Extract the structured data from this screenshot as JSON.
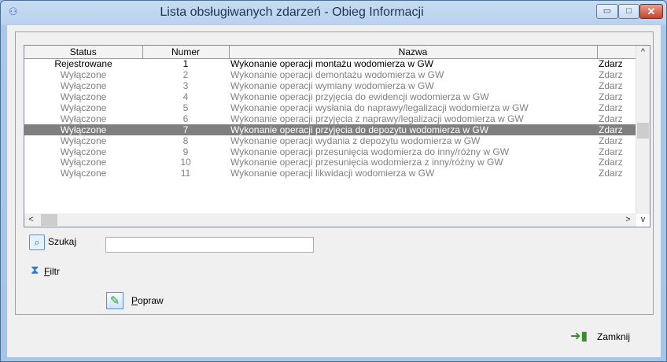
{
  "window": {
    "title": "Lista obsługiwanych zdarzeń - Obieg Informacji",
    "minimize_glyph": "▭",
    "maximize_glyph": "□",
    "close_glyph": "✕",
    "app_icon": "computer-network-icon"
  },
  "grid": {
    "columns": [
      "Status",
      "Numer",
      "Nazwa",
      ""
    ],
    "rows": [
      {
        "status": "Rejestrowane",
        "numer": "1",
        "nazwa": "Wykonanie operacji montażu wodomierza w GW",
        "typ": "Zdarz"
      },
      {
        "status": "Wyłączone",
        "numer": "2",
        "nazwa": "Wykonanie operacji demontażu wodomierza w GW",
        "typ": "Zdarz"
      },
      {
        "status": "Wyłączone",
        "numer": "3",
        "nazwa": "Wykonanie operacji wymiany wodomierza w GW",
        "typ": "Zdarz"
      },
      {
        "status": "Wyłączone",
        "numer": "4",
        "nazwa": "Wykonanie operacji przyjęcia do ewidencji wodomierza w GW",
        "typ": "Zdarz"
      },
      {
        "status": "Wyłączone",
        "numer": "5",
        "nazwa": "Wykonanie operacji wysłania do naprawy/legalizacji wodomierza w GW",
        "typ": "Zdarz"
      },
      {
        "status": "Wyłączone",
        "numer": "6",
        "nazwa": "Wykonanie operacji przyjęcia z naprawy/legalizacji wodomierza w GW",
        "typ": "Zdarz"
      },
      {
        "status": "Wyłączone",
        "numer": "7",
        "nazwa": "Wykonanie operacji przyjęcia do depozytu wodomierza w GW",
        "typ": "Zdarz"
      },
      {
        "status": "Wyłączone",
        "numer": "8",
        "nazwa": "Wykonanie operacji wydania z depozytu wodomierza w GW",
        "typ": "Zdarz"
      },
      {
        "status": "Wyłączone",
        "numer": "9",
        "nazwa": "Wykonanie operacji przesunięcia wodomierza do inny/różny w GW",
        "typ": "Zdarz"
      },
      {
        "status": "Wyłączone",
        "numer": "10",
        "nazwa": "Wykonanie operacji przesunięcia wodomierza z inny/różny w GW",
        "typ": "Zdarz"
      },
      {
        "status": "Wyłączone",
        "numer": "11",
        "nazwa": "Wykonanie operacji likwidacji wodomierza w GW",
        "typ": "Zdarz"
      }
    ],
    "selected_row": 6,
    "scroll_up": "^",
    "scroll_down": "v",
    "scroll_left": "<",
    "scroll_right": ">"
  },
  "search": {
    "label": "Szukaj",
    "value": "",
    "icon": "magnifier-icon"
  },
  "filter": {
    "label_underlined": "F",
    "label_rest": "iltr",
    "icon": "hourglass-icon"
  },
  "edit": {
    "label_underlined": "P",
    "label_rest": "opraw",
    "icon": "pencil-edit-icon"
  },
  "close": {
    "label": "Zamknij",
    "icon": "exit-door-icon"
  },
  "colors": {
    "title_bar": "#b9d2ee",
    "selected_row": "#7f7f7f",
    "disabled_text": "#808080"
  }
}
